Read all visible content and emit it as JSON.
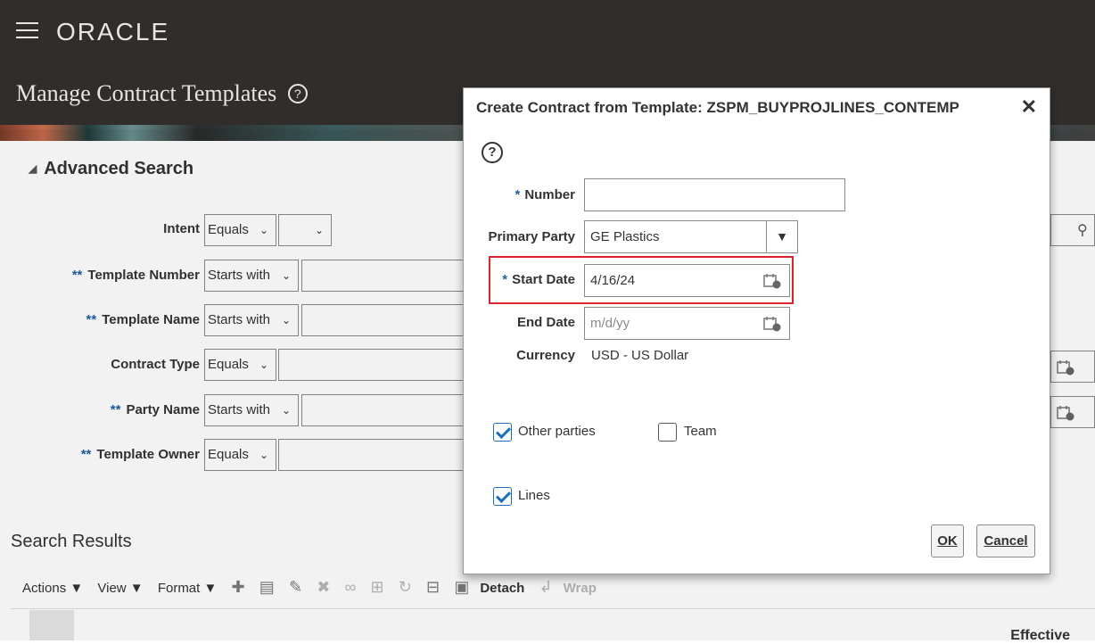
{
  "header": {
    "logo": "ORACLE",
    "page_title": "Manage Contract Templates",
    "help_glyph": "?"
  },
  "advanced_search": {
    "title": "Advanced Search",
    "fields": [
      {
        "label": "Intent",
        "required": "",
        "operator": "Equals"
      },
      {
        "label": "Template Number",
        "required": "**",
        "operator": "Starts with"
      },
      {
        "label": "Template Name",
        "required": "**",
        "operator": "Starts with"
      },
      {
        "label": "Contract Type",
        "required": "",
        "operator": "Equals"
      },
      {
        "label": "Party Name",
        "required": "**",
        "operator": "Starts with"
      },
      {
        "label": "Template Owner",
        "required": "**",
        "operator": "Equals"
      }
    ]
  },
  "search_results": {
    "title": "Search Results",
    "toolbar": {
      "actions": "Actions ▼",
      "view": "View ▼",
      "format": "Format ▼",
      "detach": "Detach",
      "wrap": "Wrap"
    },
    "column_effective": "Effective"
  },
  "dialog": {
    "title": "Create Contract from Template: ZSPM_BUYPROJLINES_CONTEMP",
    "close_glyph": "✕",
    "help_glyph": "?",
    "number": {
      "label": "Number",
      "required": "*",
      "value": ""
    },
    "primary_party": {
      "label": "Primary Party",
      "value": "GE Plastics"
    },
    "start_date": {
      "label": "Start Date",
      "required": "*",
      "value": "4/16/24"
    },
    "end_date": {
      "label": "End Date",
      "placeholder": "m/d/yy"
    },
    "currency": {
      "label": "Currency",
      "value": "USD - US Dollar"
    },
    "checkboxes": {
      "other_parties": {
        "label": "Other parties",
        "checked": true
      },
      "team": {
        "label": "Team",
        "checked": false
      },
      "lines": {
        "label": "Lines",
        "checked": true
      }
    },
    "ok_label": "OK",
    "cancel_label": "Cancel"
  }
}
